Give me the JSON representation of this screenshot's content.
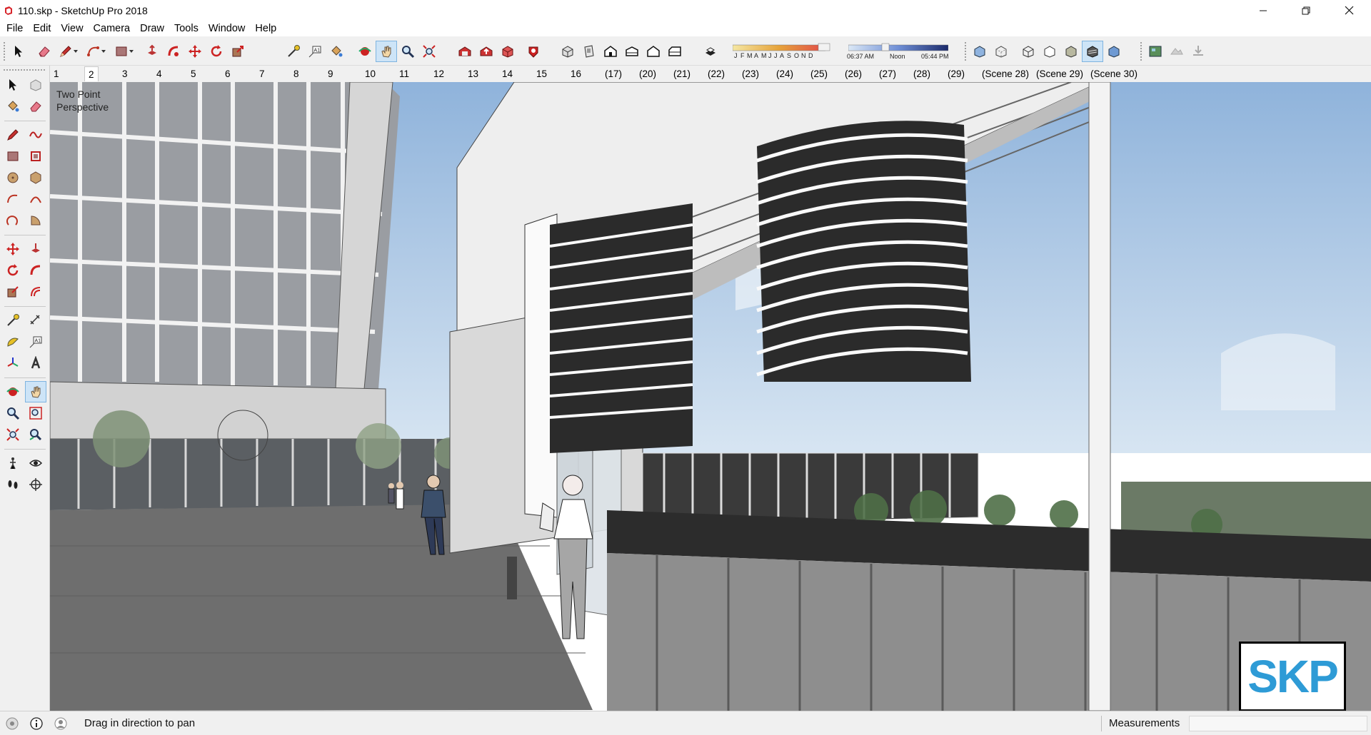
{
  "window": {
    "title": "110.skp - SketchUp Pro 2018",
    "controls": [
      "minimize-icon",
      "restore-icon",
      "close-icon"
    ]
  },
  "menu": [
    "File",
    "Edit",
    "View",
    "Camera",
    "Draw",
    "Tools",
    "Window",
    "Help"
  ],
  "toolbar": {
    "shadow_months": [
      "J",
      "F",
      "M",
      "A",
      "M",
      "J",
      "J",
      "A",
      "S",
      "O",
      "N",
      "D"
    ],
    "shadow_time_start": "06:37 AM",
    "shadow_time_noon": "Noon",
    "shadow_time_end": "05:44 PM",
    "active_tool": "pan"
  },
  "scenes": {
    "tabs": [
      "1",
      "2",
      "3",
      "4",
      "5",
      "6",
      "7",
      "8",
      "9",
      "10",
      "11",
      "12",
      "13",
      "14",
      "15",
      "16",
      "(17)",
      "(20)",
      "(21)",
      "(22)",
      "(23)",
      "(24)",
      "(25)",
      "(26)",
      "(27)",
      "(28)",
      "(29)",
      "(Scene 28)",
      "(Scene 29)",
      "(Scene 30)"
    ],
    "active_index": 1
  },
  "viewport": {
    "camera_label": "Two Point\nPerspective",
    "watermark": "SKP",
    "sky_color": "#a9c6e2",
    "ground_color": "#6b6b6b"
  },
  "status": {
    "hint": "Drag in direction to pan",
    "measurements_label": "Measurements",
    "measurements_value": ""
  }
}
